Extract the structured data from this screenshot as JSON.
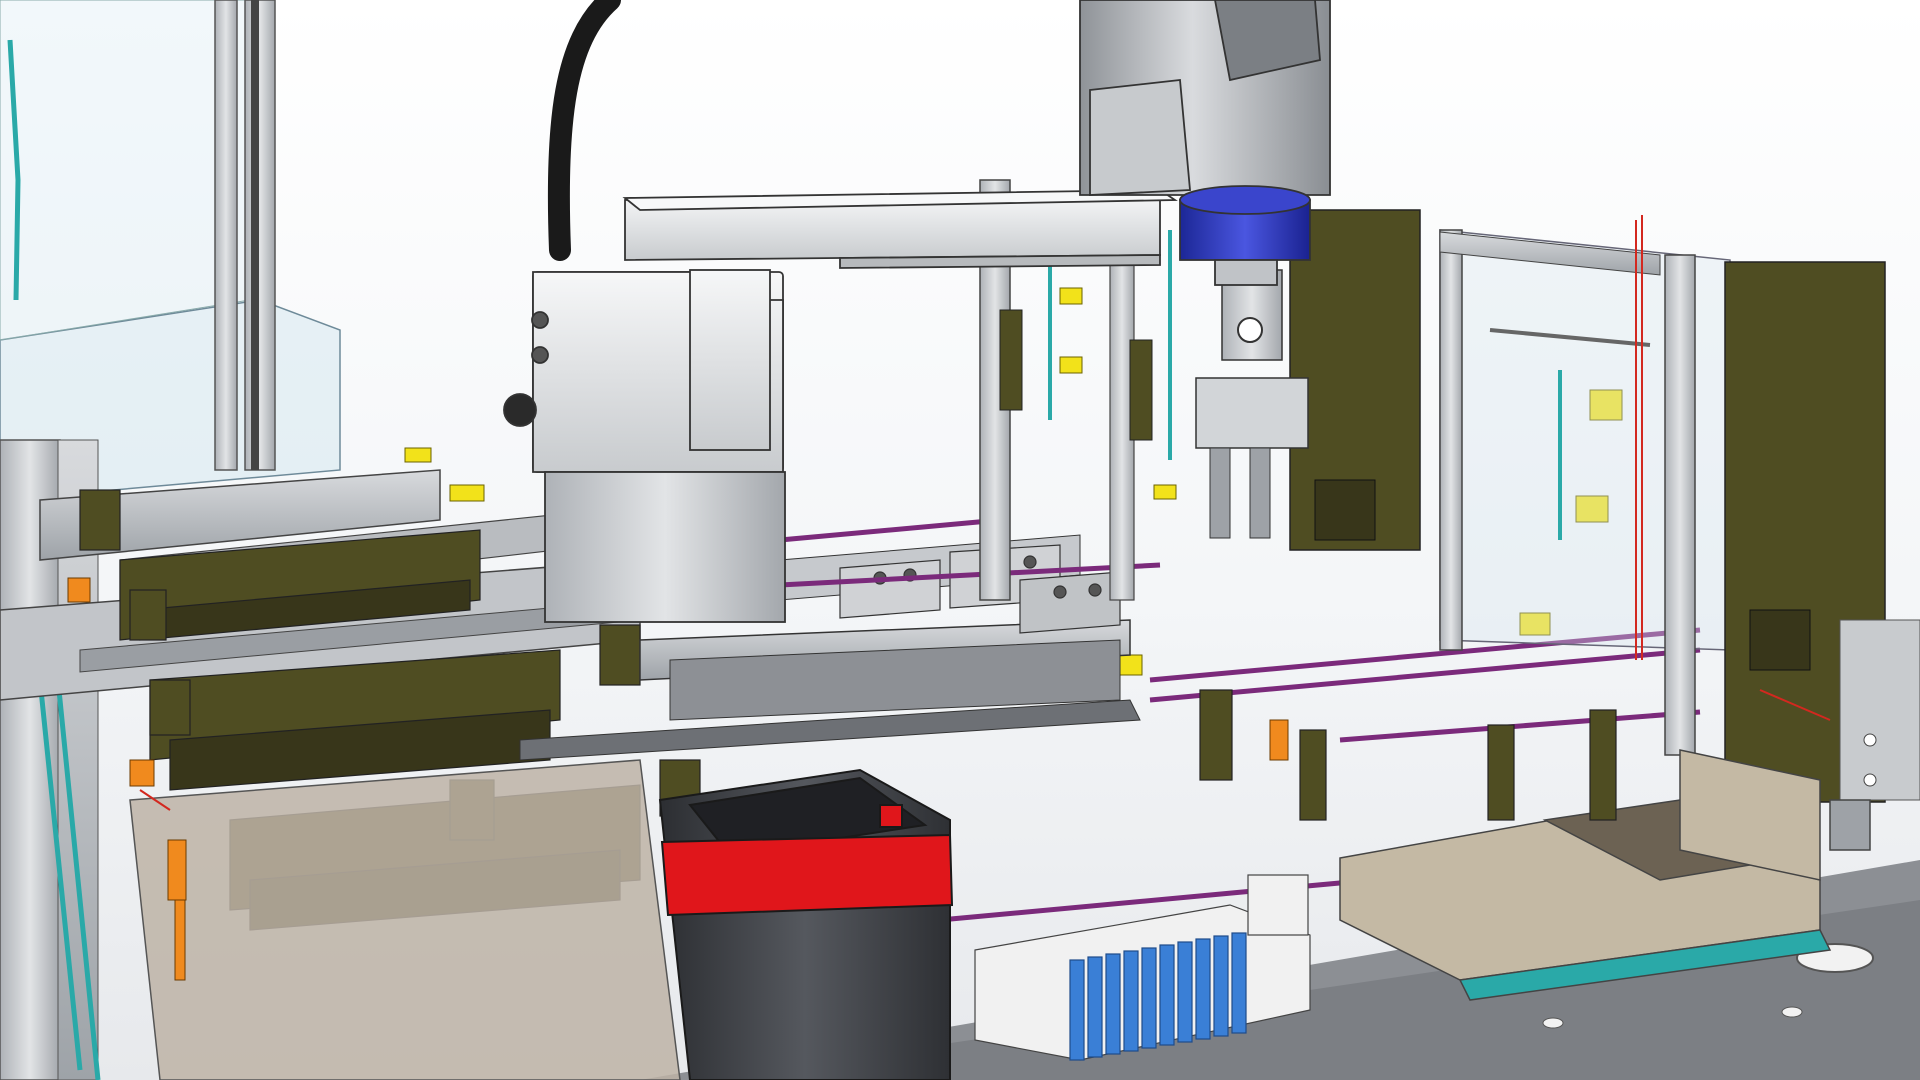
{
  "viewport": {
    "kind": "cad-assembly-render",
    "subject": "scara-robot-assembly-cell",
    "visible_text": []
  },
  "colors": {
    "background": "#ffffff",
    "aluminum_profile": "#c9ccd0",
    "aluminum_dark": "#9da2a8",
    "olive_bracket": "#4f4d22",
    "olive_dark": "#38361a",
    "sensor_yellow": "#f2e21a",
    "cable_teal": "#2aa9a8",
    "accent_orange": "#f08a1e",
    "robot_white": "#e9ebed",
    "robot_grey": "#b4b7bb",
    "flange_blue": "#2a33b8",
    "guard_glass": "#cfe4ee",
    "conveyor_purple": "#7b2a7b",
    "bin_dark": "#3d3f44",
    "bin_red": "#e0161b",
    "valve_blue": "#3a7fd6",
    "tray_tan": "#c4b9a4",
    "base_plate": "#888b90",
    "wire_red": "#d3281f",
    "sheet_metal": "#bdb3a6"
  },
  "icons": [
    "scara-robot",
    "cable-carrier",
    "pneumatic-cylinder",
    "proximity-sensor",
    "parts-bin",
    "valve-manifold",
    "feeder-tray",
    "aluminum-frame"
  ]
}
